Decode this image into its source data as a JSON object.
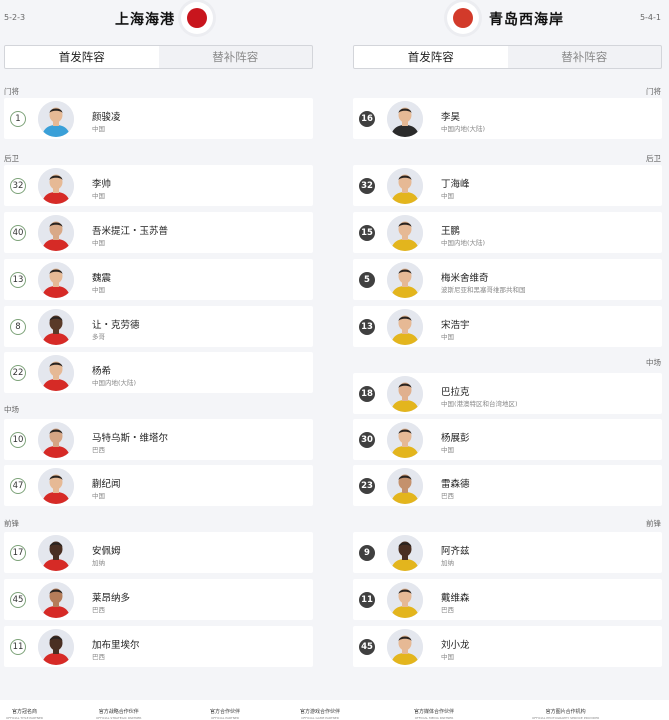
{
  "home": {
    "formation": "5-2-3",
    "name": "上海海港",
    "logo_color": "#c8151d",
    "players": [
      {
        "section": "门将",
        "number": "1",
        "name": "颜骏凌",
        "nationality": "中国",
        "skin": "#e6b995",
        "kit": "#3aa0d8"
      },
      {
        "section": "后卫",
        "number": "32",
        "name": "李帅",
        "nationality": "中国",
        "skin": "#e6b995",
        "kit": "#d62a26"
      },
      {
        "number": "40",
        "name": "吾米提江・玉苏普",
        "nationality": "中国",
        "skin": "#d9a987",
        "kit": "#d62a26"
      },
      {
        "number": "13",
        "name": "魏震",
        "nationality": "中国",
        "skin": "#e6b995",
        "kit": "#d62a26"
      },
      {
        "number": "8",
        "name": "让・克劳德",
        "nationality": "多哥",
        "skin": "#5a3a28",
        "kit": "#d62a26"
      },
      {
        "number": "22",
        "name": "杨希",
        "nationality": "中国内地(大陆)",
        "skin": "#e6b995",
        "kit": "#d62a26"
      },
      {
        "section": "中场",
        "number": "10",
        "name": "马特乌斯・维塔尔",
        "nationality": "巴西",
        "skin": "#d6a584",
        "kit": "#d62a26"
      },
      {
        "number": "47",
        "name": "蒯纪闻",
        "nationality": "中国",
        "skin": "#e6b995",
        "kit": "#d62a26"
      },
      {
        "section": "前锋",
        "number": "17",
        "name": "安佩姆",
        "nationality": "加纳",
        "skin": "#4a2f22",
        "kit": "#d62a26"
      },
      {
        "number": "45",
        "name": "莱昂纳多",
        "nationality": "巴西",
        "skin": "#b57d5a",
        "kit": "#d62a26"
      },
      {
        "number": "11",
        "name": "加布里埃尔",
        "nationality": "巴西",
        "skin": "#4a2f22",
        "kit": "#d62a26"
      }
    ]
  },
  "away": {
    "formation": "5-4-1",
    "name": "青岛西海岸",
    "logo_color": "#d23a2a",
    "players": [
      {
        "section": "门将",
        "number": "16",
        "name": "李昊",
        "nationality": "中国内地(大陆)",
        "skin": "#e6b995",
        "kit": "#2b2b2b"
      },
      {
        "section": "后卫",
        "number": "32",
        "name": "丁海峰",
        "nationality": "中国",
        "skin": "#e6b995",
        "kit": "#e3b51d"
      },
      {
        "number": "15",
        "name": "王鹏",
        "nationality": "中国内地(大陆)",
        "skin": "#e6b995",
        "kit": "#e3b51d"
      },
      {
        "number": "5",
        "name": "梅米舍维奇",
        "nationality": "波斯尼亚和黑塞哥维那共和国",
        "skin": "#e6b995",
        "kit": "#e3b51d"
      },
      {
        "number": "13",
        "name": "宋浩宇",
        "nationality": "中国",
        "skin": "#e6b995",
        "kit": "#e3b51d"
      },
      {
        "section": "中场",
        "number": "18",
        "name": "巴拉克",
        "nationality": "中国(港澳特区和台湾地区)",
        "skin": "#e0b08e",
        "kit": "#e3b51d"
      },
      {
        "number": "30",
        "name": "杨展彭",
        "nationality": "中国",
        "skin": "#e6b995",
        "kit": "#e3b51d"
      },
      {
        "number": "23",
        "name": "雷森德",
        "nationality": "巴西",
        "skin": "#c4916c",
        "kit": "#e3b51d"
      },
      {
        "section": "前锋",
        "number": "9",
        "name": "阿齐兹",
        "nationality": "加纳",
        "skin": "#4a2f22",
        "kit": "#e3b51d"
      },
      {
        "number": "11",
        "name": "戴维森",
        "nationality": "巴西",
        "skin": "#e6b995",
        "kit": "#e3b51d"
      },
      {
        "number": "45",
        "name": "刘小龙",
        "nationality": "中国",
        "skin": "#e6b995",
        "kit": "#e3b51d"
      }
    ]
  },
  "tabs": {
    "starting": "首发阵容",
    "subs": "替补阵容"
  },
  "footer": [
    {
      "label": "官方冠名商",
      "sub": "OFFICIAL TITLE PARTNER"
    },
    {
      "label": "官方战略合作伙伴",
      "sub": "OFFICIAL STRATEGIC PARTNER"
    },
    {
      "label": "官方合作伙伴",
      "sub": "OFFICIAL PARTNER"
    },
    {
      "label": "官方游戏合作伙伴",
      "sub": "OFFICIAL GAME PARTNER"
    },
    {
      "label": "官方媒体合作伙伴",
      "sub": "OFFICIAL MEDIA PARTNER"
    },
    {
      "label": "官方图片合作机构",
      "sub": "OFFICIAL PHOTOGRAPHY SERVICE PROVIDER"
    }
  ]
}
